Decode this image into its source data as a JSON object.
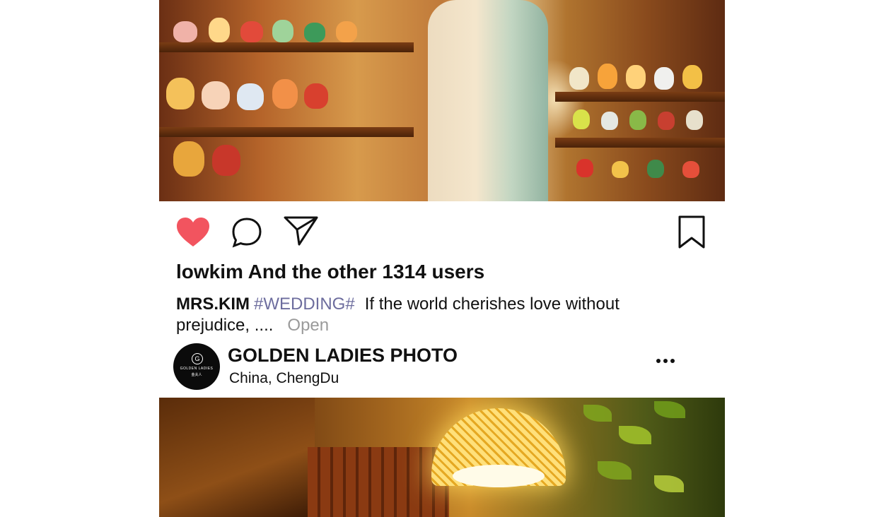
{
  "post": {
    "likes_text": "lowkim And the other 1314 users",
    "caption": {
      "username": "MRS.KIM",
      "hashtag": "#WEDDING#",
      "text_line1": "If the world cherishes love without",
      "text_line2": "prejudice, ....",
      "open_label": "Open"
    },
    "colors": {
      "like_active": "#f2545f",
      "hashtag": "#6d6d9e",
      "open": "#9a9a9a",
      "text": "#111111"
    }
  },
  "account": {
    "name": "GOLDEN LADIES PHOTO",
    "location_country": "China,",
    "location_city": "ChengDu",
    "avatar_brand": "GOLDEN LADIES",
    "avatar_sub": "金夫人"
  },
  "icons": {
    "like": "heart-icon",
    "comment": "comment-bubble-icon",
    "share": "paper-plane-icon",
    "save": "bookmark-icon",
    "more": "ellipsis-icon"
  }
}
